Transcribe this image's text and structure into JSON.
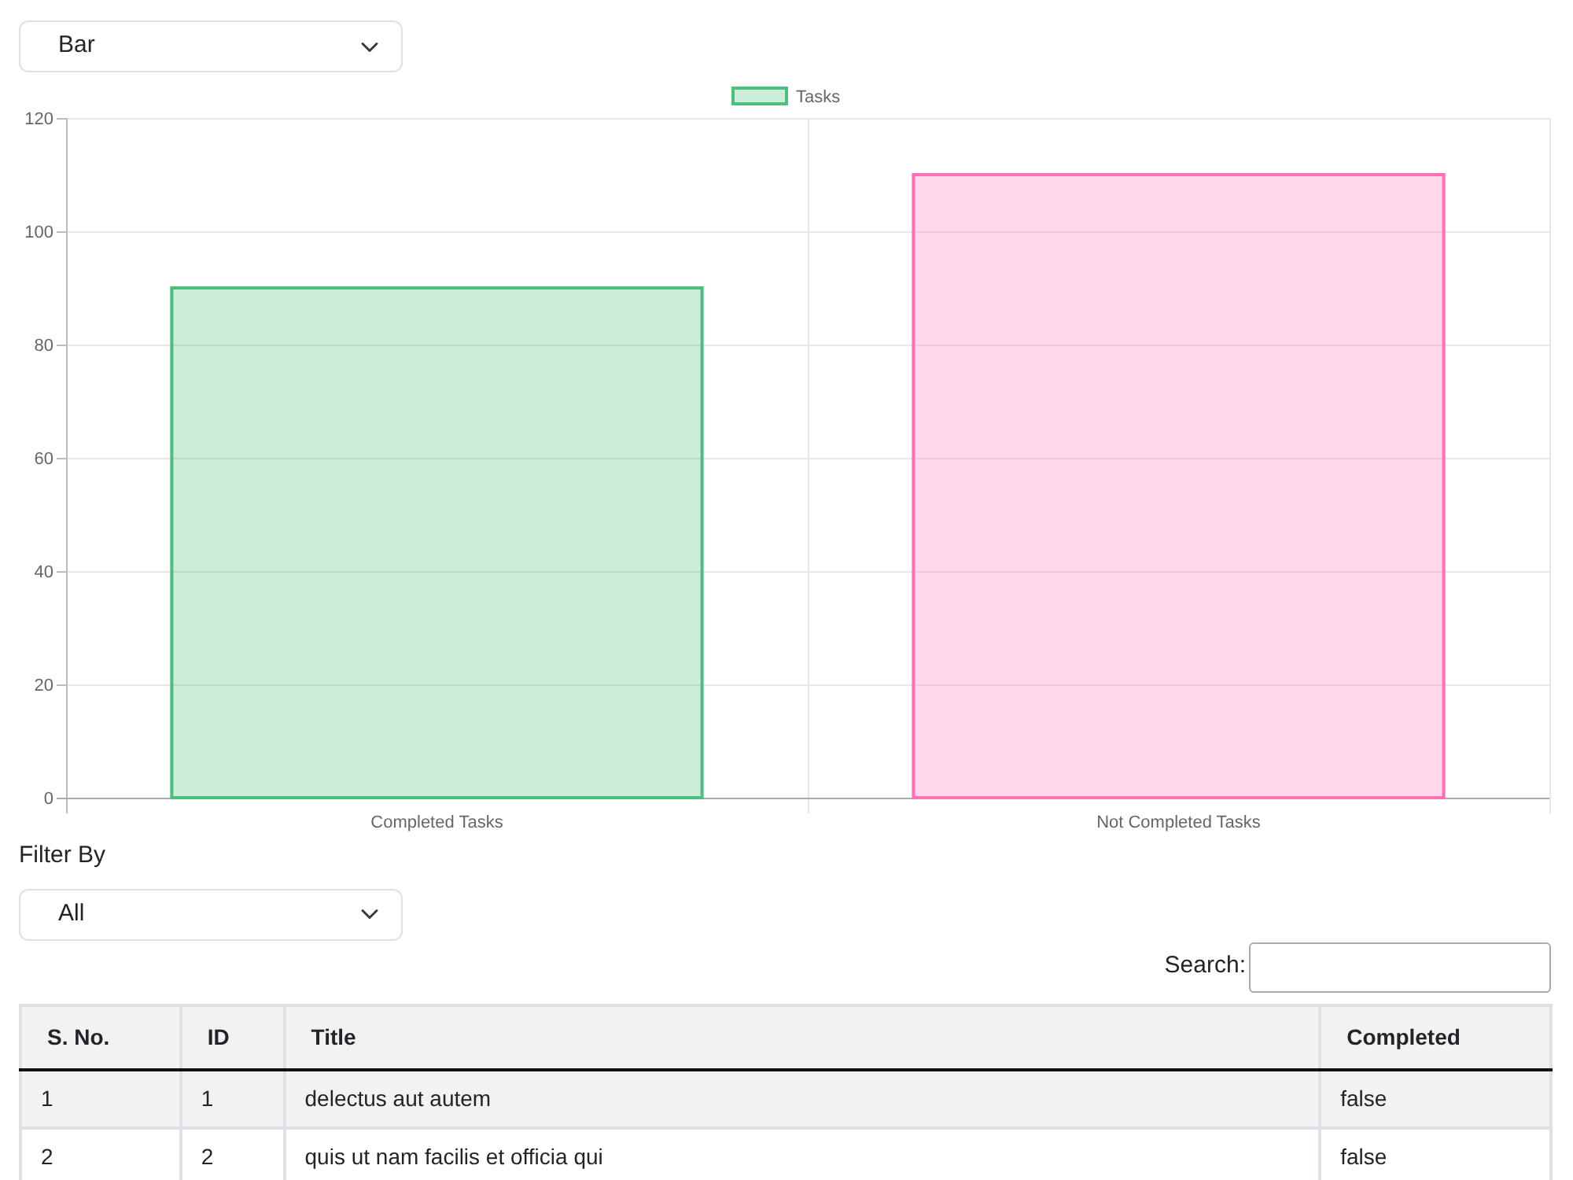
{
  "chart_type_select": {
    "value": "Bar"
  },
  "chart": {
    "chart_data": {
      "type": "bar",
      "categories": [
        "Completed Tasks",
        "Not Completed Tasks"
      ],
      "series": [
        {
          "name": "Tasks",
          "color": [
            "#4bc07d",
            "#ff6fb5"
          ],
          "values": [
            90,
            110
          ]
        }
      ],
      "grid": true,
      "ylim": [
        0,
        120
      ],
      "yticks": [
        0,
        20,
        40,
        60,
        80,
        100,
        120
      ]
    }
  },
  "filter": {
    "label": "Filter By",
    "value": "All"
  },
  "search": {
    "label": "Search:"
  },
  "table": {
    "columns": [
      "S. No.",
      "ID",
      "Title",
      "Completed"
    ],
    "rows": [
      {
        "cells": [
          "1",
          "1",
          "delectus aut autem",
          "false"
        ]
      },
      {
        "cells": [
          "2",
          "2",
          "quis ut nam facilis et officia qui",
          "false"
        ]
      }
    ]
  }
}
